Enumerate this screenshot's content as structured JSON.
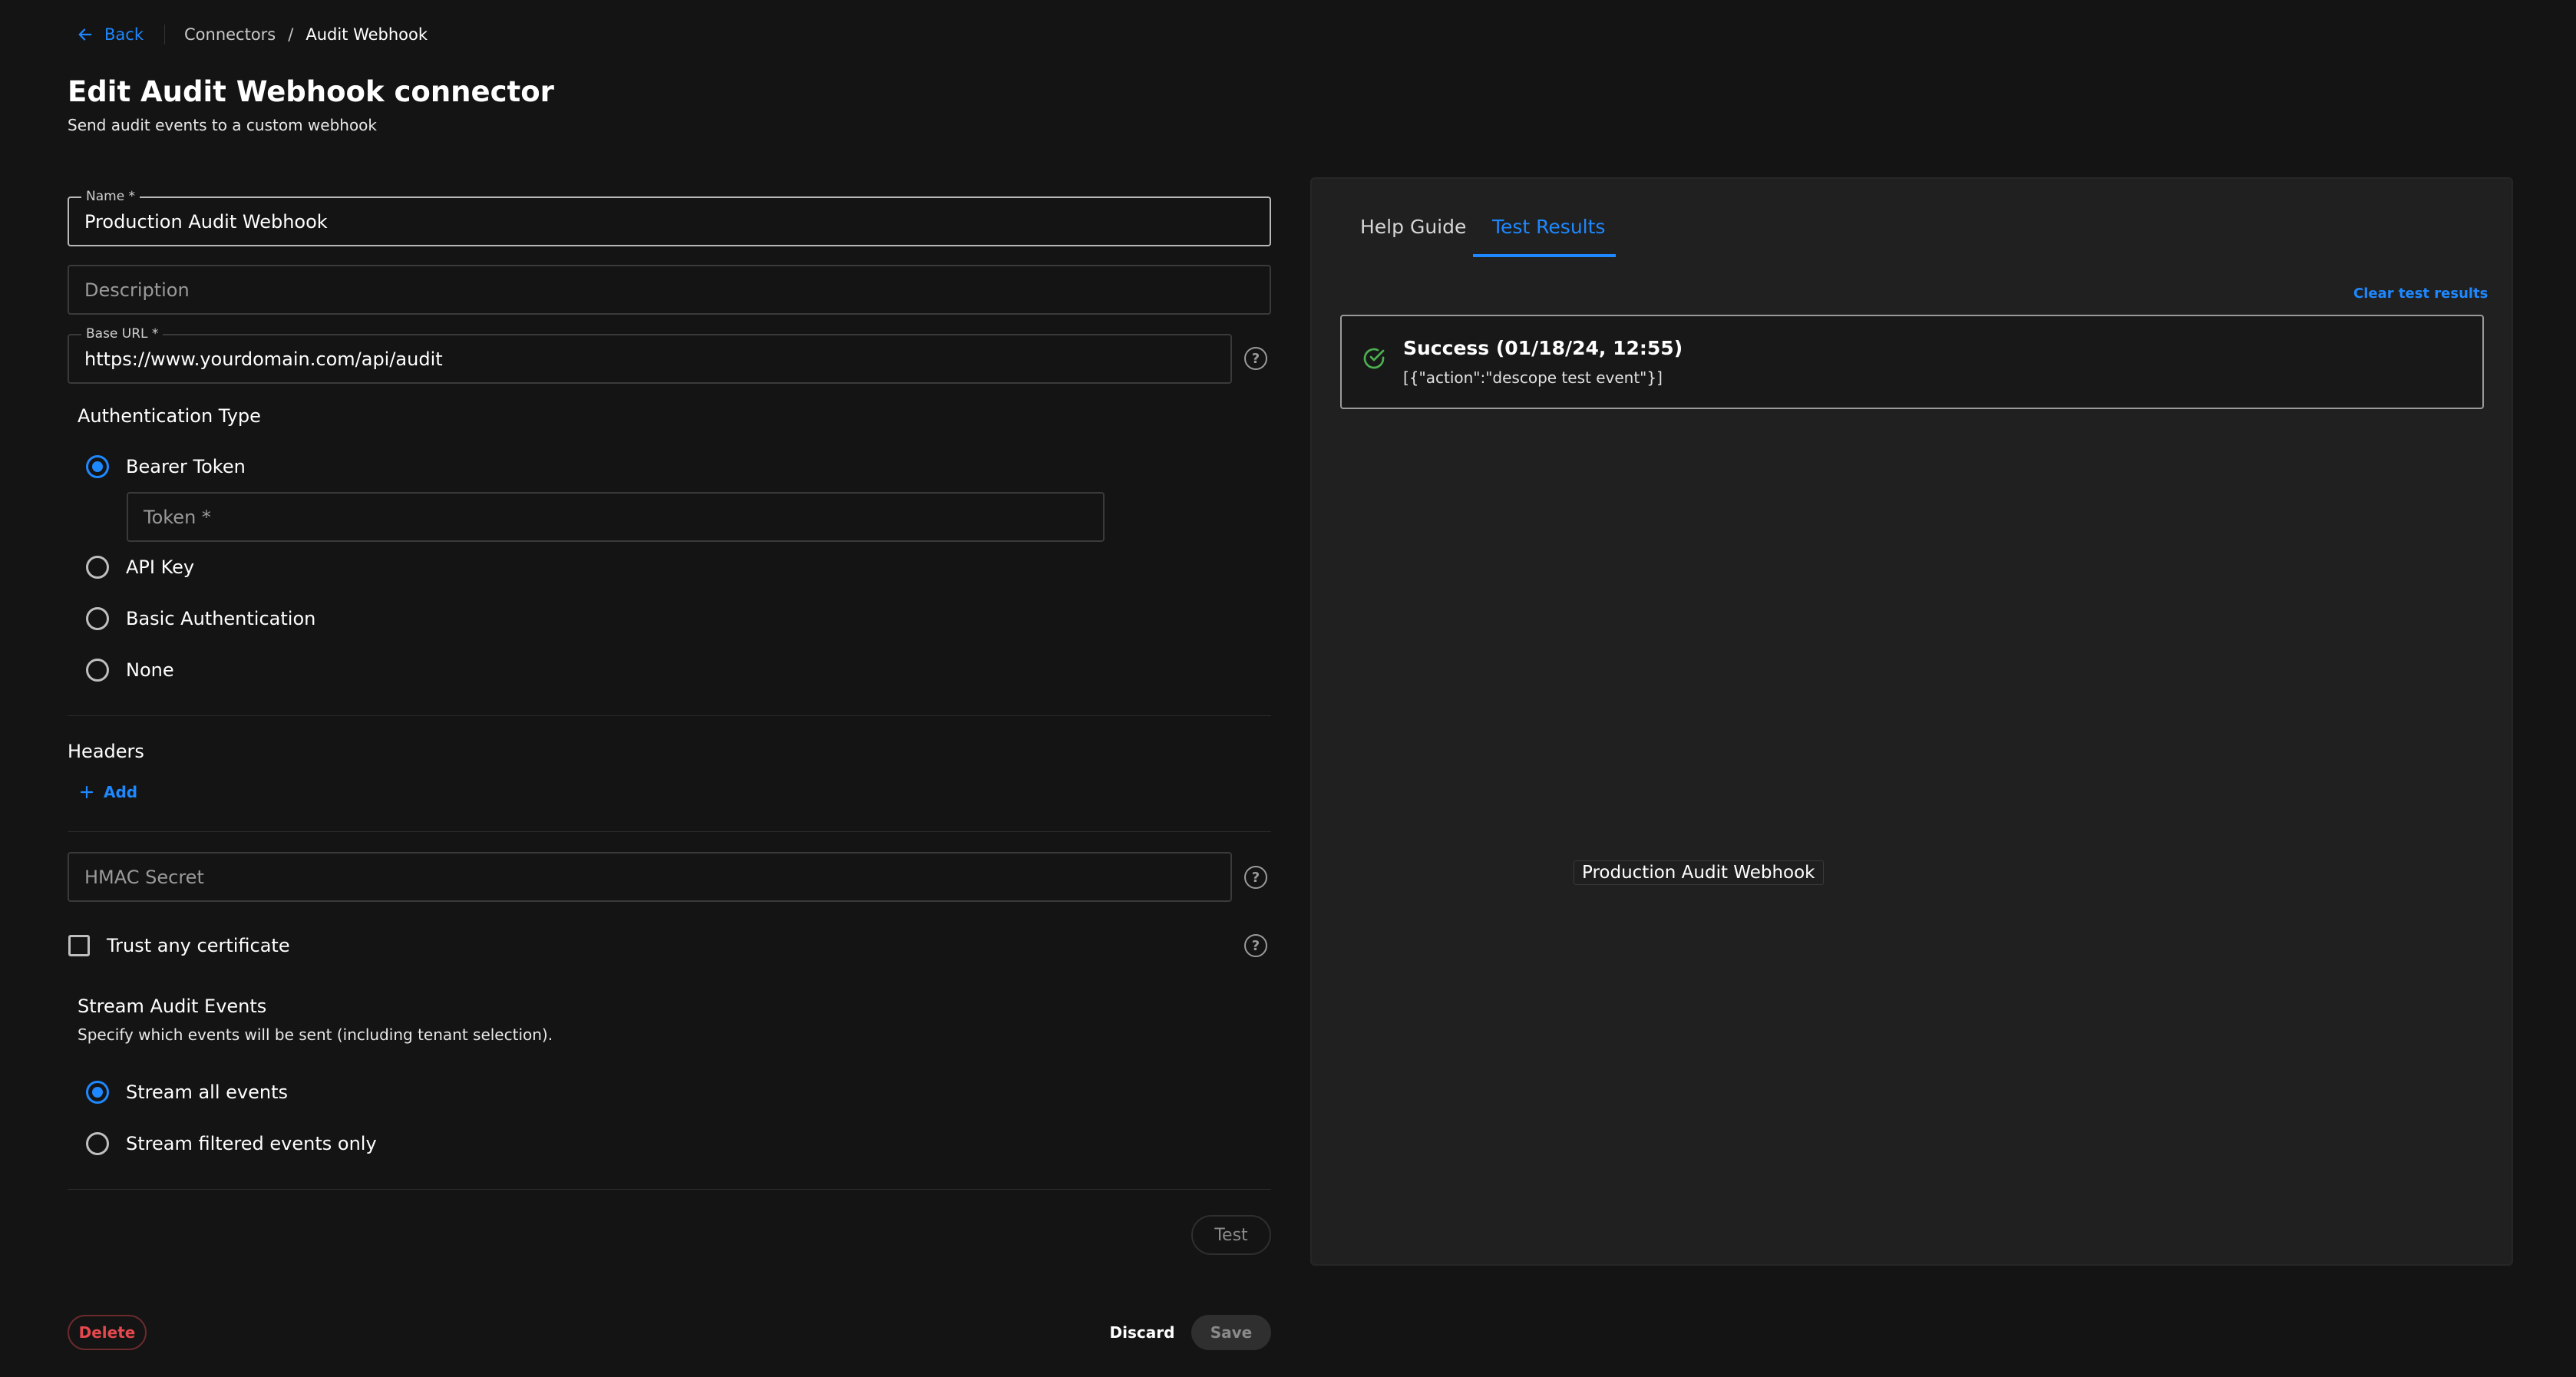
{
  "header": {
    "back_label": "Back",
    "breadcrumb": [
      "Connectors",
      "/",
      "Audit Webhook"
    ],
    "title": "Edit Audit Webhook connector",
    "subtitle": "Send audit events to a custom webhook"
  },
  "form": {
    "name": {
      "label": "Name *",
      "value": "Production Audit Webhook"
    },
    "description": {
      "placeholder": "Description"
    },
    "base_url": {
      "label": "Base URL *",
      "value": "https://www.yourdomain.com/api/audit"
    },
    "auth": {
      "title": "Authentication Type",
      "options": [
        "Bearer Token",
        "API Key",
        "Basic Authentication",
        "None"
      ],
      "selected": "Bearer Token",
      "token_placeholder": "Token *"
    },
    "headers": {
      "title": "Headers",
      "add_label": "Add"
    },
    "hmac": {
      "placeholder": "HMAC Secret"
    },
    "trust_cert": {
      "label": "Trust any certificate",
      "checked": false
    },
    "stream": {
      "title": "Stream Audit Events",
      "description": "Specify which events will be sent (including tenant selection).",
      "options": [
        "Stream all events",
        "Stream filtered events only"
      ],
      "selected": "Stream all events"
    },
    "test_label": "Test"
  },
  "footer": {
    "delete_label": "Delete",
    "discard_label": "Discard",
    "save_label": "Save"
  },
  "panel": {
    "tabs": [
      "Help Guide",
      "Test Results"
    ],
    "active_tab": "Test Results",
    "clear_label": "Clear test results",
    "result": {
      "status": "Success (01/18/24, 12:55)",
      "payload": "[{\"action\":\"descope test event\"}]"
    },
    "tooltip": "Production Audit Webhook"
  },
  "colors": {
    "accent": "#1e88ff",
    "danger": "#e5484d",
    "success": "#4caf50",
    "background": "#141414",
    "panel": "#202020"
  }
}
